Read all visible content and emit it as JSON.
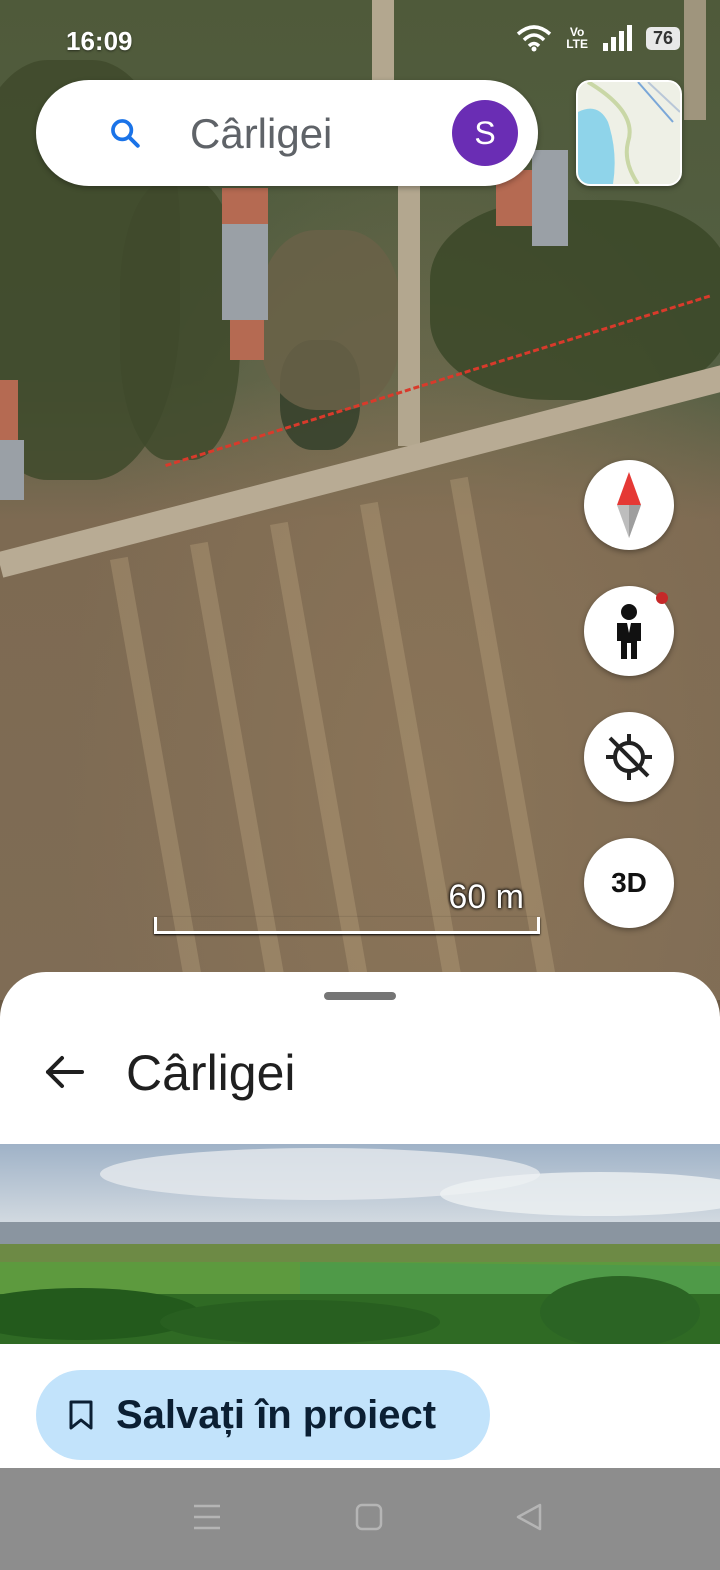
{
  "status_bar": {
    "time": "16:09",
    "network": "Vo\nLTE",
    "battery": "76"
  },
  "search": {
    "text": "Cârligei",
    "avatar_letter": "S"
  },
  "map_controls": {
    "three_d_label": "3D",
    "scale_label": "60 m"
  },
  "place_sheet": {
    "title": "Cârligei",
    "save_button_label": "Salvați în proiect"
  },
  "icons": [
    "search-icon",
    "compass-icon",
    "pegman-icon",
    "location-off-icon",
    "back-arrow-icon",
    "bookmark-icon",
    "recent-apps-icon",
    "home-icon",
    "back-nav-icon"
  ]
}
